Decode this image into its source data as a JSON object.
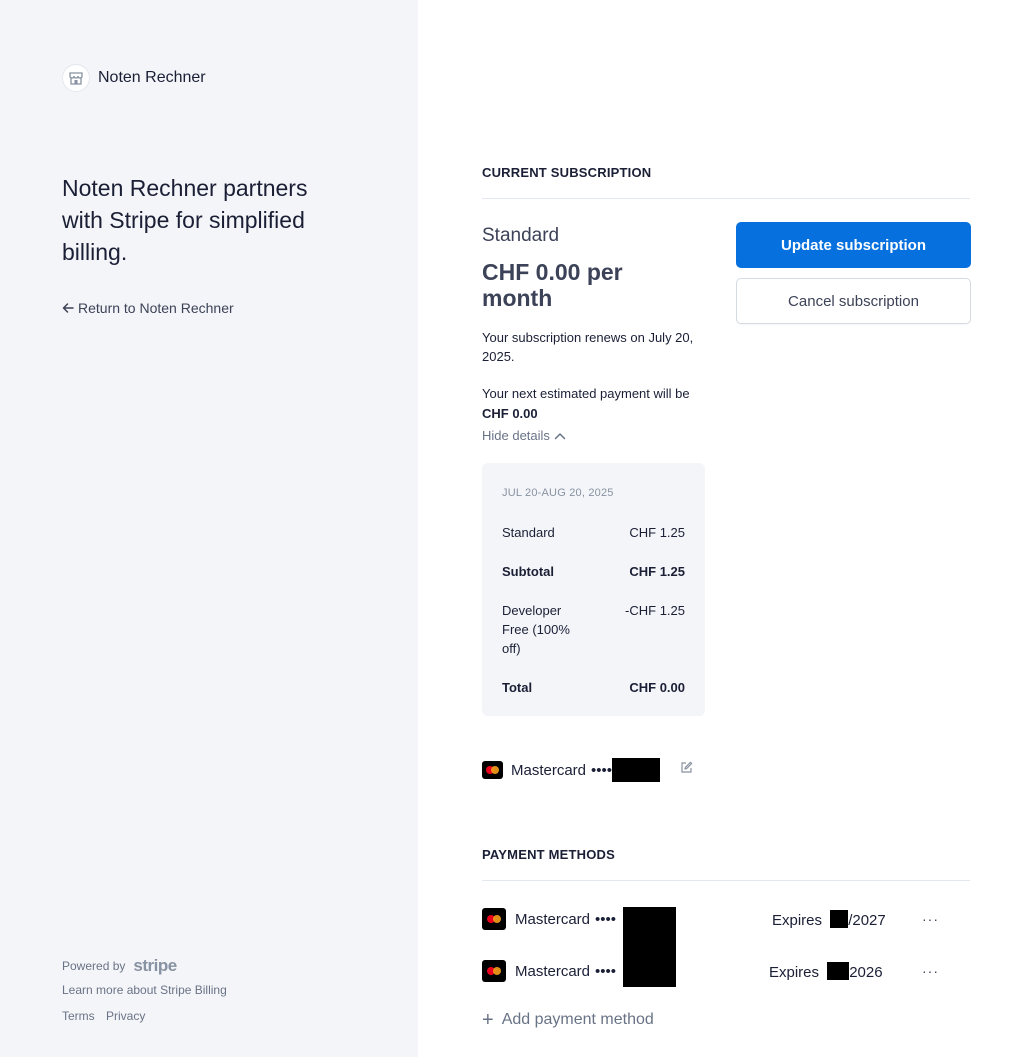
{
  "sidebar": {
    "brand_name": "Noten Rechner",
    "tagline": "Noten Rechner partners with Stripe for simplified billing.",
    "return_link": "Return to Noten Rechner",
    "powered_by": "Powered by",
    "stripe_logo": "stripe",
    "learn_more": "Learn more about Stripe Billing",
    "terms": "Terms",
    "privacy": "Privacy"
  },
  "subscription": {
    "section_title": "CURRENT SUBSCRIPTION",
    "plan_name": "Standard",
    "price": "CHF 0.00 per month",
    "renews_text": "Your subscription renews on July 20, 2025.",
    "next_payment_prefix": "Your next estimated payment will be ",
    "next_payment_amount": "CHF 0.00",
    "hide_details": "Hide details",
    "update_button": "Update subscription",
    "cancel_button": "Cancel subscription",
    "details": {
      "period": "JUL 20-AUG 20, 2025",
      "lines": [
        {
          "label": "Standard",
          "amount": "CHF 1.25",
          "bold": false
        },
        {
          "label": "Subtotal",
          "amount": "CHF 1.25",
          "bold": true
        },
        {
          "label": "Developer Free (100% off)",
          "amount": "-CHF 1.25",
          "bold": false
        },
        {
          "label": "Total",
          "amount": "CHF 0.00",
          "bold": true
        }
      ]
    },
    "current_card": {
      "brand": "Mastercard",
      "masked": "••••"
    }
  },
  "payment_methods": {
    "section_title": "PAYMENT METHODS",
    "cards": [
      {
        "brand": "Mastercard",
        "masked": "••••",
        "expires_label": "Expires",
        "expires_year": "/2027"
      },
      {
        "brand": "Mastercard",
        "masked": "••••",
        "expires_label": "Expires",
        "expires_year": "2026"
      }
    ],
    "more_label": "···",
    "add_label": "Add payment method"
  },
  "colors": {
    "accent": "#0570de",
    "sidebar_bg": "#f4f5f8",
    "text": "#1a1f36",
    "muted": "#697386"
  },
  "icons": [
    "store-icon",
    "arrow-left-icon",
    "chevron-up-icon",
    "mastercard-icon",
    "edit-icon",
    "more-icon",
    "plus-icon"
  ]
}
